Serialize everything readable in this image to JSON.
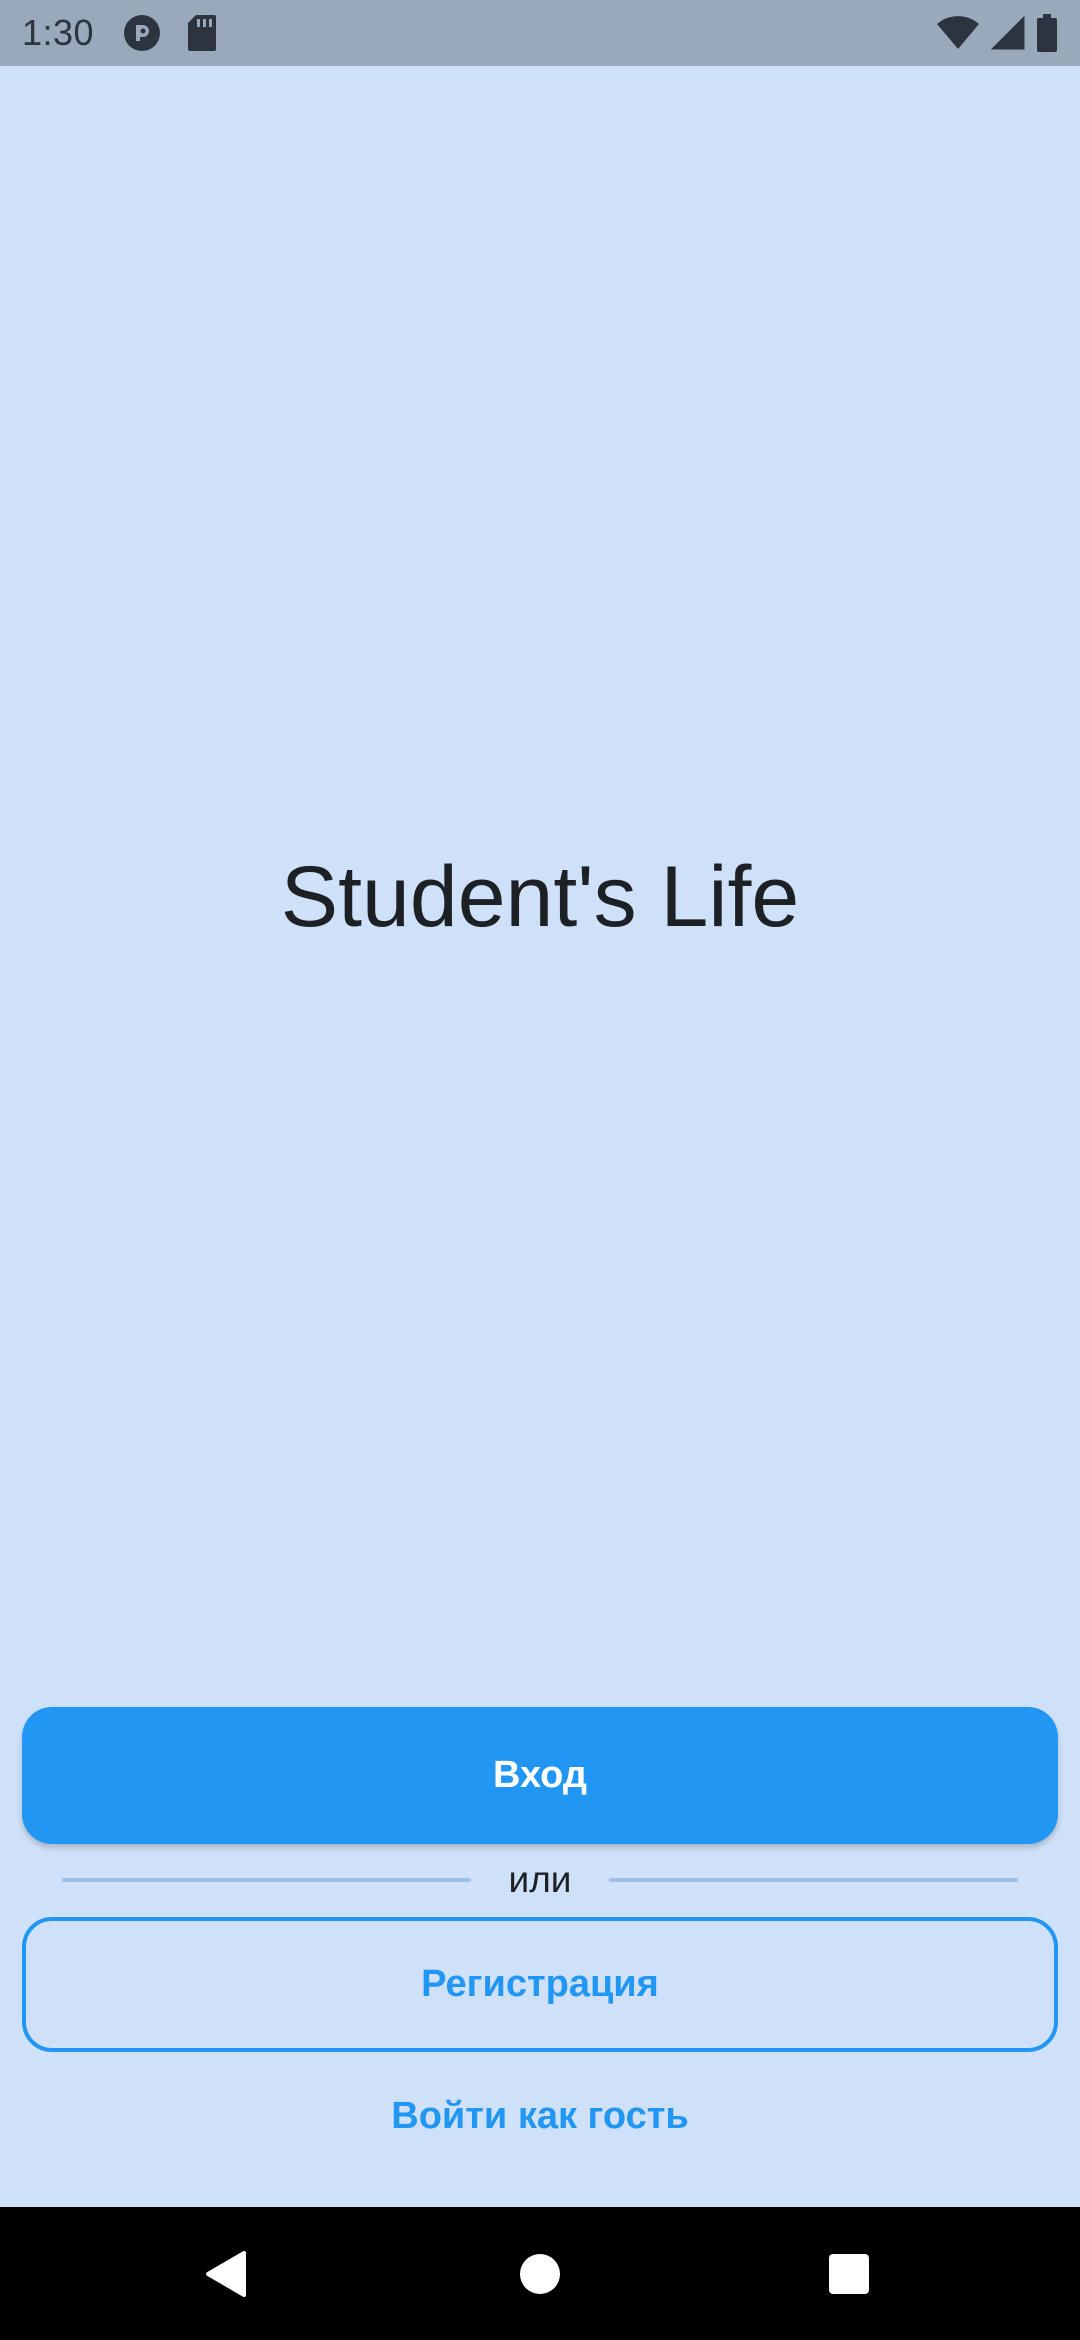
{
  "status_bar": {
    "time": "1:30",
    "left_icons": [
      "record-icon",
      "sd-card-icon"
    ],
    "right_icons": [
      "wifi-icon",
      "cellular-signal-icon",
      "battery-icon"
    ]
  },
  "main": {
    "title": "Student's Life"
  },
  "actions": {
    "login_label": "Вход",
    "divider_label": "или",
    "register_label": "Регистрация",
    "guest_label": "Войти как гость"
  },
  "nav_bar": {
    "buttons": [
      "back-icon",
      "home-icon",
      "recents-icon"
    ]
  },
  "colors": {
    "background": "#cfe1f8",
    "accent": "#2196f3",
    "status_bar": "#9aa8bb",
    "nav_bar": "#000000"
  }
}
